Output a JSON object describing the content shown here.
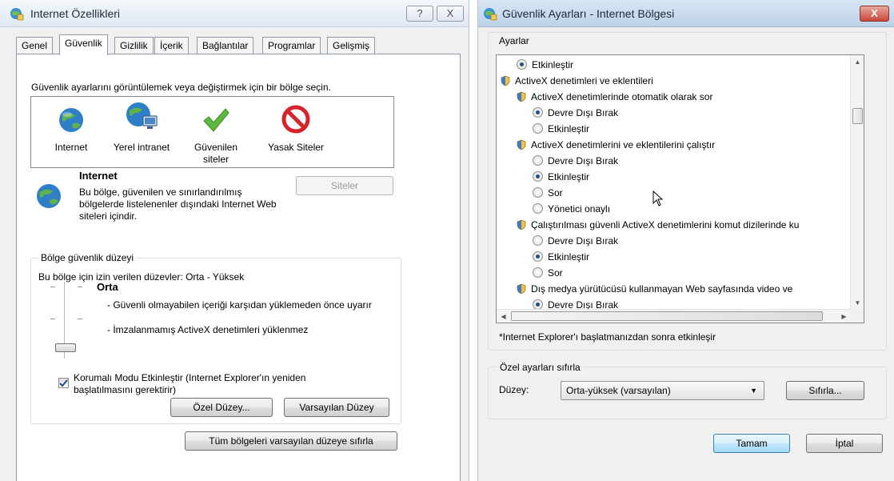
{
  "left_window": {
    "title": "Internet Özellikleri",
    "help_label": "?",
    "close_label": "X",
    "tabs": [
      {
        "label": "Genel"
      },
      {
        "label": "Güvenlik"
      },
      {
        "label": "Gizlilik"
      },
      {
        "label": "İçerik"
      },
      {
        "label": "Bağlantılar"
      },
      {
        "label": "Programlar"
      },
      {
        "label": "Gelişmiş"
      }
    ],
    "active_tab": "Güvenlik",
    "zone_prompt": "Güvenlik ayarlarını görüntülemek veya değiştirmek için bir bölge seçin.",
    "zones": [
      {
        "label": "Internet",
        "icon": "globe-icon"
      },
      {
        "label": "Yerel intranet",
        "icon": "intranet-icon"
      },
      {
        "label": "Güvenilen siteler",
        "icon": "checkmark-icon"
      },
      {
        "label": "Yasak Siteler",
        "icon": "prohibited-icon"
      }
    ],
    "selected_zone": {
      "name": "Internet",
      "description": "Bu bölge, güvenilen ve sınırlandırılmış bölgelerde listelenenler dışındaki Internet Web siteleri içindir.",
      "sites_button": "Siteler"
    },
    "security_level": {
      "group_title": "Bölge güvenlik düzeyi",
      "allowed_text": "Bu bölge için izin verilen düzevler: Orta - Yüksek",
      "level_name": "Orta",
      "bullets": [
        "- Güvenli olmayabilen içeriği karşıdan yüklemeden önce uyarır",
        "- İmzalanmamış ActiveX denetimleri yüklenmez"
      ],
      "slider_position": "Orta"
    },
    "protected_mode": {
      "label": "Korumalı Modu Etkinleştir (Internet Explorer'ın yeniden başlatılmasını gerektirir)",
      "checked": true
    },
    "buttons": {
      "custom_level": "Özel Düzey...",
      "default_level": "Varsayılan Düzey",
      "reset_all": "Tüm bölgeleri varsayılan düzeye sıfırla"
    }
  },
  "right_window": {
    "title": "Güvenlik Ayarları - Internet Bölgesi",
    "close_label": "X",
    "settings_label": "Ayarlar",
    "tree": [
      {
        "type": "radio",
        "label": "Etkinleştir",
        "checked": true,
        "indent": 1
      },
      {
        "type": "category",
        "label": "ActiveX denetimleri ve eklentileri",
        "indent": 0
      },
      {
        "type": "category",
        "label": "ActiveX denetimlerinde otomatik olarak sor",
        "indent": 1
      },
      {
        "type": "radio",
        "label": "Devre Dışı Bırak",
        "checked": true,
        "indent": 2
      },
      {
        "type": "radio",
        "label": "Etkinleştir",
        "checked": false,
        "indent": 2
      },
      {
        "type": "category",
        "label": "ActiveX denetimlerini ve eklentilerini çalıştır",
        "indent": 1
      },
      {
        "type": "radio",
        "label": "Devre Dışı Bırak",
        "checked": false,
        "indent": 2
      },
      {
        "type": "radio",
        "label": "Etkinleştir",
        "checked": true,
        "indent": 2
      },
      {
        "type": "radio",
        "label": "Sor",
        "checked": false,
        "indent": 2
      },
      {
        "type": "radio",
        "label": "Yönetici onaylı",
        "checked": false,
        "indent": 2
      },
      {
        "type": "category",
        "label": "Çalıştırılması güvenli ActiveX denetimlerini komut dizilerinde ku",
        "indent": 1
      },
      {
        "type": "radio",
        "label": "Devre Dışı Bırak",
        "checked": false,
        "indent": 2
      },
      {
        "type": "radio",
        "label": "Etkinleştir",
        "checked": true,
        "indent": 2
      },
      {
        "type": "radio",
        "label": "Sor",
        "checked": false,
        "indent": 2
      },
      {
        "type": "category",
        "label": "Dış medya yürütücüsü kullanmayan Web sayfasında video ve",
        "indent": 1
      },
      {
        "type": "radio",
        "label": "Devre Dışı Bırak",
        "checked": true,
        "indent": 2
      }
    ],
    "restart_note": "*Internet Explorer'ı başlatmanızdan sonra etkinleşir",
    "reset_group": {
      "title": "Özel ayarları sıfırla",
      "level_label": "Düzey:",
      "selected_level": "Orta-yüksek (varsayılan)",
      "reset_button": "Sıfırla..."
    },
    "ok_button": "Tamam",
    "cancel_button": "İptal"
  }
}
